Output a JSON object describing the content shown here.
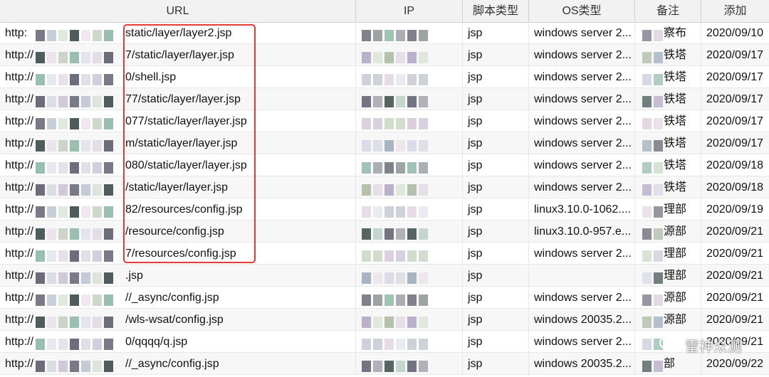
{
  "columns": [
    "URL",
    "IP",
    "脚本类型",
    "OS类型",
    "备注",
    "添加"
  ],
  "rows": [
    {
      "url_prefix": "http:",
      "url_suffix": "static/layer/layer2.jsp",
      "type": "jsp",
      "os": "windows server 2...",
      "note": "察布",
      "date": "2020/09/10"
    },
    {
      "url_prefix": "http://",
      "url_suffix": "7/static/layer/layer.jsp",
      "type": "jsp",
      "os": "windows server 2...",
      "note": "铁塔",
      "date": "2020/09/17"
    },
    {
      "url_prefix": "http://",
      "url_suffix": "0/shell.jsp",
      "type": "jsp",
      "os": "windows server 2...",
      "note": "铁塔",
      "date": "2020/09/17"
    },
    {
      "url_prefix": "http://",
      "url_suffix": "77/static/layer/layer.jsp",
      "type": "jsp",
      "os": "windows server 2...",
      "note": "铁塔",
      "date": "2020/09/17"
    },
    {
      "url_prefix": "http://",
      "url_suffix": "077/static/layer/layer.jsp",
      "type": "jsp",
      "os": "windows server 2...",
      "note": "铁塔",
      "date": "2020/09/17"
    },
    {
      "url_prefix": "http://",
      "url_suffix": "m/static/layer/layer.jsp",
      "type": "jsp",
      "os": "windows server 2...",
      "note": "铁塔",
      "date": "2020/09/17"
    },
    {
      "url_prefix": "http://",
      "url_suffix": "080/static/layer/layer.jsp",
      "type": "jsp",
      "os": "windows server 2...",
      "note": "铁塔",
      "date": "2020/09/18"
    },
    {
      "url_prefix": "http://",
      "url_suffix": "/static/layer/layer.jsp",
      "type": "jsp",
      "os": "windows server 2...",
      "note": "铁塔",
      "date": "2020/09/18"
    },
    {
      "url_prefix": "http://",
      "url_suffix": "82/resources/config.jsp",
      "type": "jsp",
      "os": "linux3.10.0-1062....",
      "note": "理部",
      "date": "2020/09/19"
    },
    {
      "url_prefix": "http://",
      "url_suffix": "/resource/config.jsp",
      "type": "jsp",
      "os": "linux3.10.0-957.e...",
      "note": "源部",
      "date": "2020/09/21"
    },
    {
      "url_prefix": "http://",
      "url_suffix": "7/resources/config.jsp",
      "type": "jsp",
      "os": "windows server 2...",
      "note": "理部",
      "date": "2020/09/21"
    },
    {
      "url_prefix": "http://",
      "url_suffix": ".jsp",
      "type": "jsp",
      "os": "",
      "note": "理部",
      "date": "2020/09/21"
    },
    {
      "url_prefix": "http://",
      "url_suffix": "//_async/config.jsp",
      "type": "jsp",
      "os": "windows server 2...",
      "note": "源部",
      "date": "2020/09/21"
    },
    {
      "url_prefix": "http://",
      "url_suffix": "/wls-wsat/config.jsp",
      "type": "jsp",
      "os": "windows 20035.2...",
      "note": "源部",
      "date": "2020/09/21"
    },
    {
      "url_prefix": "http://",
      "url_suffix": "0/qqqq/q.jsp",
      "type": "jsp",
      "os": "windows server 2...",
      "note": "",
      "date": "2020/09/21"
    },
    {
      "url_prefix": "http://",
      "url_suffix": "//_async/config.jsp",
      "type": "jsp",
      "os": "windows 20035.2...",
      "note": "部",
      "date": "2020/09/22"
    }
  ],
  "watermark": "雷神众测"
}
